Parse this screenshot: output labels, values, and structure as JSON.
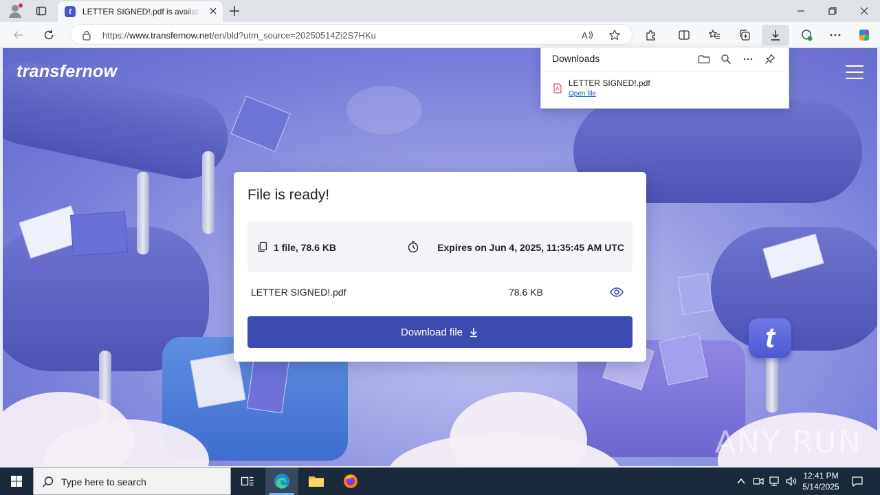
{
  "browser": {
    "tab": {
      "title": "LETTER SIGNED!.pdf is available f",
      "favicon_letter": "t"
    },
    "url": {
      "prefix": "https://",
      "domain": "www.transfernow.net",
      "path": "/en/bld?utm_source=20250514Zi2S7HKu"
    }
  },
  "page": {
    "logo": "transfernow",
    "card": {
      "title": "File is ready!",
      "files_count": "1 file, 78.6 KB",
      "expires": "Expires on Jun 4, 2025, 11:35:45 AM UTC",
      "file_name": "LETTER SIGNED!.pdf",
      "file_size": "78.6 KB",
      "download_label": "Download file"
    },
    "badge_letter": "t"
  },
  "downloads_panel": {
    "title": "Downloads",
    "item": {
      "filename": "LETTER SIGNED!.pdf",
      "action": "Open file"
    }
  },
  "watermark": "ANY RUN",
  "taskbar": {
    "search_placeholder": "Type here to search",
    "time": "12:41 PM",
    "date": "5/14/2025"
  },
  "colors": {
    "accent": "#3d4ab0",
    "page_bg": "#7a7fda",
    "taskbar": "#1b2a3a",
    "link": "#0f5fc1"
  }
}
